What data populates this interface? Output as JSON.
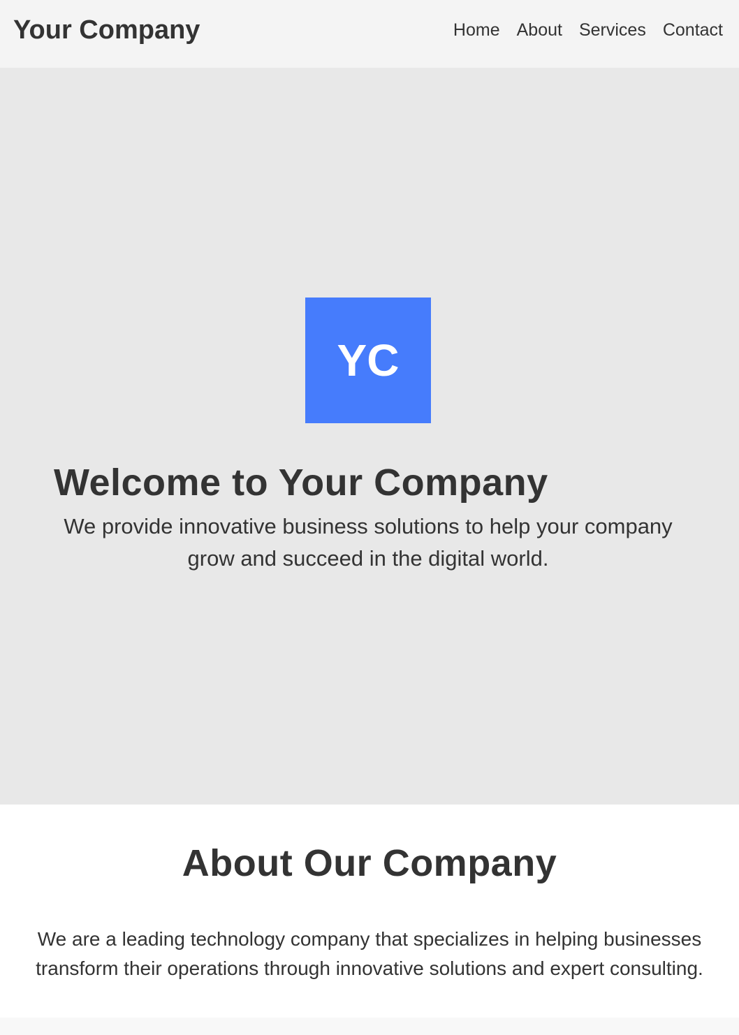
{
  "header": {
    "brand": "Your Company",
    "nav": [
      {
        "label": "Home"
      },
      {
        "label": "About"
      },
      {
        "label": "Services"
      },
      {
        "label": "Contact"
      }
    ]
  },
  "hero": {
    "logo_text": "YC",
    "title": "Welcome to Your Company",
    "subtitle": "We provide innovative business solutions to help your company grow and succeed in the digital world."
  },
  "about": {
    "title": "About Our Company",
    "text": "We are a leading technology company that specializes in helping businesses transform their operations through innovative solutions and expert consulting."
  },
  "colors": {
    "accent": "#467cfc",
    "text": "#333333",
    "header_bg": "#f4f4f4",
    "hero_bg": "#e8e8e8",
    "section_bg": "#ffffff"
  }
}
